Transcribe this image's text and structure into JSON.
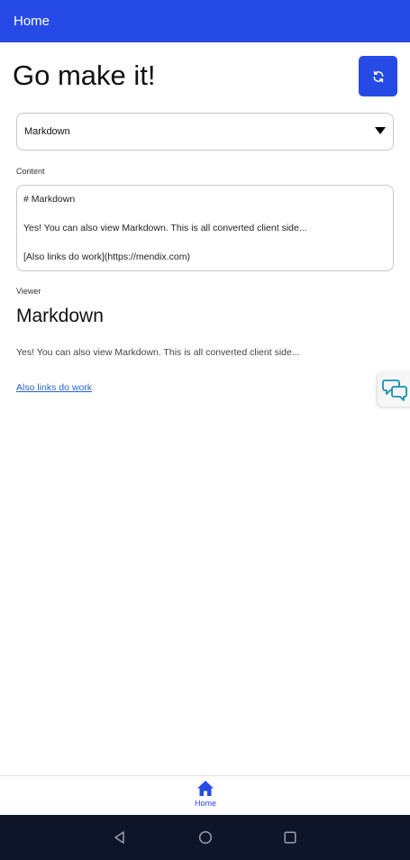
{
  "header": {
    "title": "Home"
  },
  "page": {
    "title": "Go make it!"
  },
  "dropdown": {
    "selected": "Markdown"
  },
  "content": {
    "label": "Content",
    "lines": [
      "# Markdown",
      "Yes! You can also view Markdown. This is all converted client side...",
      "[Also links do work](https://mendix.com)"
    ]
  },
  "viewer": {
    "label": "Viewer",
    "heading": "Markdown",
    "paragraph": "Yes! You can also view Markdown. This is all converted client side...",
    "link_text": "Also links do work"
  },
  "tabbar": {
    "home_label": "Home"
  },
  "icons": {
    "refresh": "refresh-icon",
    "chat": "chat-bubbles-icon",
    "home": "house-icon",
    "nav_back": "triangle-back-icon",
    "nav_home": "circle-home-icon",
    "nav_recent": "square-recent-icon"
  },
  "colors": {
    "brand": "#264ae5",
    "link": "#2a64c8",
    "chat_icon": "#1a8fb5",
    "navbar": "#0e1528"
  }
}
